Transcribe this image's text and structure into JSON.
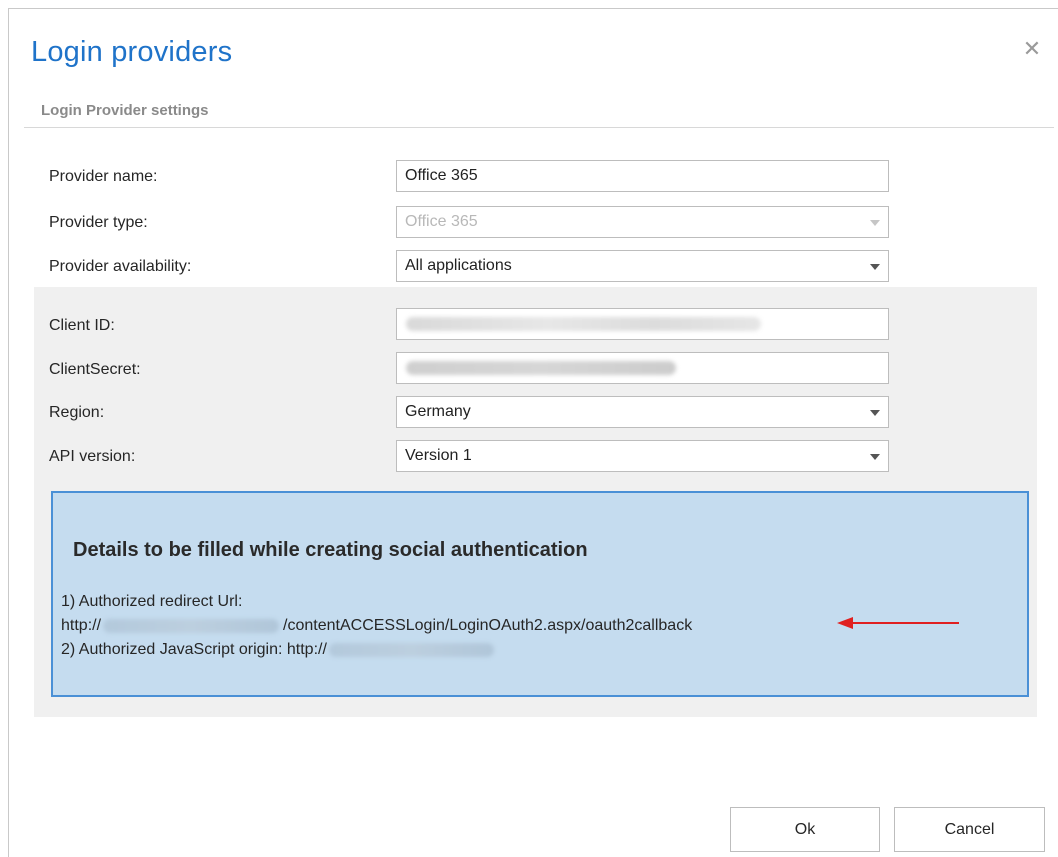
{
  "dialog": {
    "title": "Login providers",
    "close_icon": "close-icon",
    "section_header": "Login Provider settings"
  },
  "form": {
    "provider_name": {
      "label": "Provider name:",
      "value": "Office 365"
    },
    "provider_type": {
      "label": "Provider type:",
      "value": "Office 365"
    },
    "provider_availability": {
      "label": "Provider availability:",
      "value": "All applications"
    },
    "client_id": {
      "label": "Client ID:"
    },
    "client_secret": {
      "label": "ClientSecret:"
    },
    "region": {
      "label": "Region:",
      "value": "Germany"
    },
    "api_version": {
      "label": "API version:",
      "value": "Version 1"
    }
  },
  "info": {
    "title": "Details to be filled while creating social authentication",
    "line1": "1) Authorized redirect Url:",
    "line2_prefix": "http://",
    "line2_suffix": "/contentACCESSLogin/LoginOAuth2.aspx/oauth2callback",
    "line3_prefix": "2) Authorized JavaScript origin: http://",
    "arrow_color": "#e02020"
  },
  "buttons": {
    "ok": "Ok",
    "cancel": "Cancel"
  },
  "colors": {
    "accent": "#1f73c9",
    "info_bg": "#c5dcef",
    "info_border": "#4a90d6"
  }
}
